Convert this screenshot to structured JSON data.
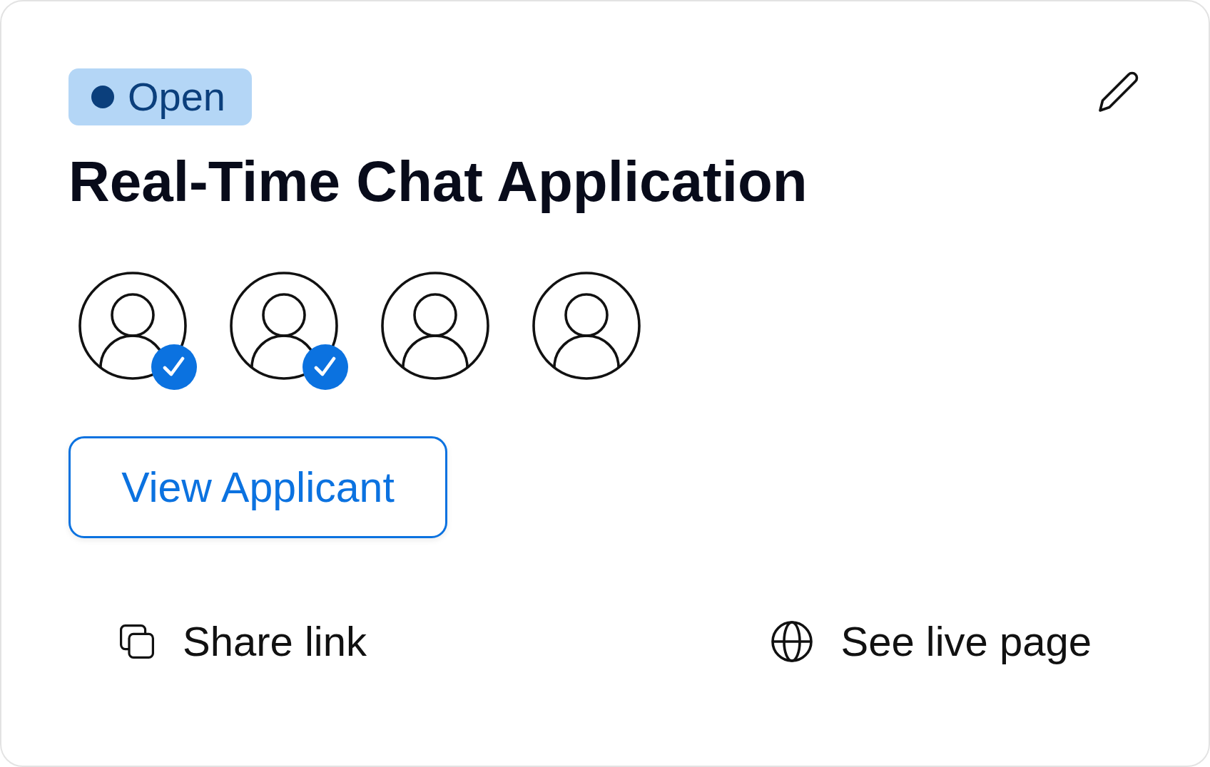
{
  "card": {
    "status_badge": {
      "label": "Open"
    },
    "title": "Real-Time Chat Application",
    "applicants": [
      {
        "checked": true
      },
      {
        "checked": true
      },
      {
        "checked": false
      },
      {
        "checked": false
      }
    ],
    "primary_button": {
      "label": "View Applicant"
    },
    "actions": [
      {
        "kind": "copy",
        "label": "Share link"
      },
      {
        "kind": "globe",
        "label": "See live page"
      }
    ]
  }
}
